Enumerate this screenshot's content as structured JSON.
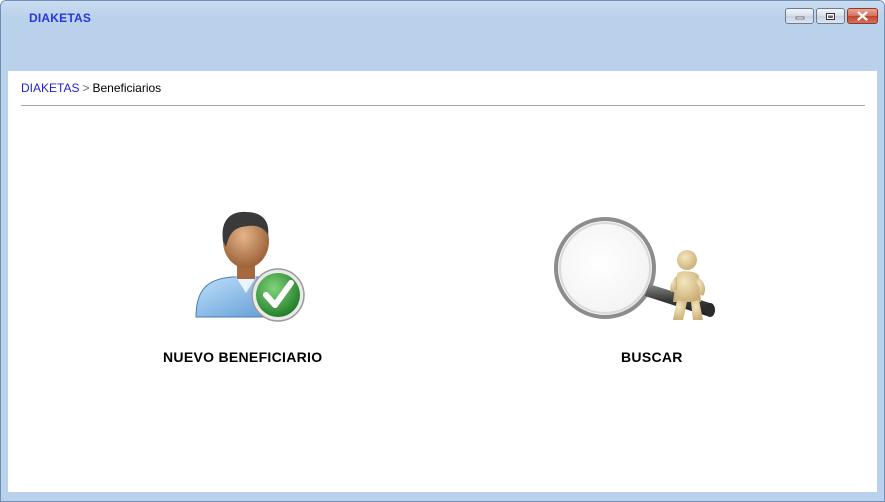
{
  "window": {
    "title": "DIAKETAS",
    "controls": {
      "minimize": "minimize-icon",
      "maximize": "maximize-icon",
      "close": "close-icon"
    }
  },
  "breadcrumb": {
    "root": "DIAKETAS",
    "separator": ">",
    "current": "Beneficiarios"
  },
  "actions": [
    {
      "label": "NUEVO BENEFICIARIO",
      "icon": "user-checkmark-icon"
    },
    {
      "label": "BUSCAR",
      "icon": "magnifier-figure-icon"
    }
  ],
  "colors": {
    "title": "#2a35e0",
    "link": "#2420d6",
    "chrome": "#b9d1ea",
    "check": "#3aa23a"
  }
}
